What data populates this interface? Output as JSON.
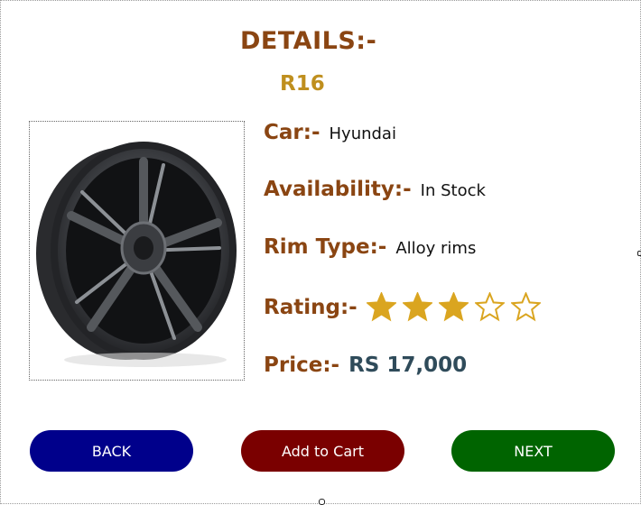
{
  "details_title": "DETAILS:-",
  "product_size": "R16",
  "image": {
    "alt": "alloy wheel rim"
  },
  "fields": {
    "car": {
      "label": "Car:-",
      "value": "Hyundai"
    },
    "availability": {
      "label": "Availability:-",
      "value": "In Stock"
    },
    "rim_type": {
      "label": "Rim Type:-",
      "value": "Alloy rims"
    },
    "rating": {
      "label": "Rating:-",
      "value": 3,
      "max": 5
    },
    "price": {
      "label": "Price:-",
      "value": "RS 17,000"
    }
  },
  "buttons": {
    "back": "BACK",
    "add_to_cart": "Add to Cart",
    "next": "NEXT"
  },
  "colors": {
    "label": "#8a4512",
    "size": "#bf8f1e",
    "star": "#daa520",
    "price": "#2f4b5a",
    "back_button": "#00008b",
    "cart_button": "#7a0000",
    "next_button": "#006400"
  },
  "icons": {
    "star_filled": "star-filled-icon",
    "star_empty": "star-outline-icon"
  }
}
